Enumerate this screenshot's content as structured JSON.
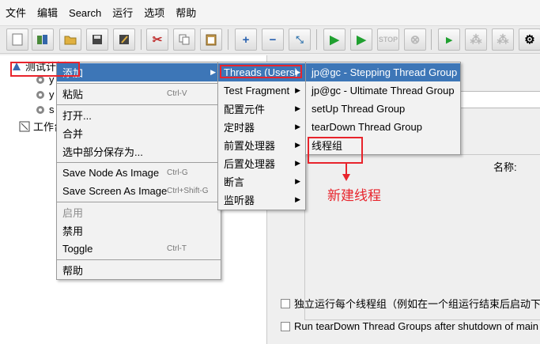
{
  "menubar": [
    "文件",
    "编辑",
    "Search",
    "运行",
    "选项",
    "帮助"
  ],
  "toolbar": [
    "new",
    "templates",
    "open",
    "save",
    "save-as",
    "cut",
    "copy",
    "paste",
    "expand",
    "collapse",
    "toggle",
    "start",
    "start-no-pauses",
    "stop",
    "shutdown",
    "remote-start",
    "remote-stop",
    "remote-shutdown",
    "clear"
  ],
  "tree": {
    "test_plan": "测试计划",
    "child1": "y",
    "child2": "y",
    "child3": "s",
    "workbench": "工作台"
  },
  "context_menu": {
    "add": "添加",
    "paste": "粘贴",
    "paste_shortcut": "Ctrl-V",
    "open": "打开...",
    "merge": "合并",
    "save_selection": "选中部分保存为...",
    "save_node_image": "Save Node As Image",
    "save_node_image_shortcut": "Ctrl-G",
    "save_screen_image": "Save Screen As Image",
    "save_screen_image_shortcut": "Ctrl+Shift-G",
    "enable": "启用",
    "disable": "禁用",
    "toggle": "Toggle",
    "toggle_shortcut": "Ctrl-T",
    "help": "帮助"
  },
  "add_submenu": {
    "threads": "Threads (Users)",
    "test_fragment": "Test Fragment",
    "config_element": "配置元件",
    "timer": "定时器",
    "pre_processor": "前置处理器",
    "post_processor": "后置处理器",
    "assertion": "断言",
    "listener": "监听器"
  },
  "threads_submenu": {
    "stepping": "jp@gc - Stepping Thread Group",
    "ultimate": "jp@gc - Ultimate Thread Group",
    "setup": "setUp Thread Group",
    "teardown": "tearDown Thread Group",
    "thread_group": "线程组"
  },
  "right_panel": {
    "name_label": "名称:",
    "checkbox1": "独立运行每个线程组（例如在一个组运行结束后启动下",
    "checkbox2": "Run tearDown Thread Groups after shutdown of main th"
  },
  "annotation": "新建线程",
  "colors": {
    "highlight": "#3d76b7",
    "annotation_red": "#e8242c"
  }
}
